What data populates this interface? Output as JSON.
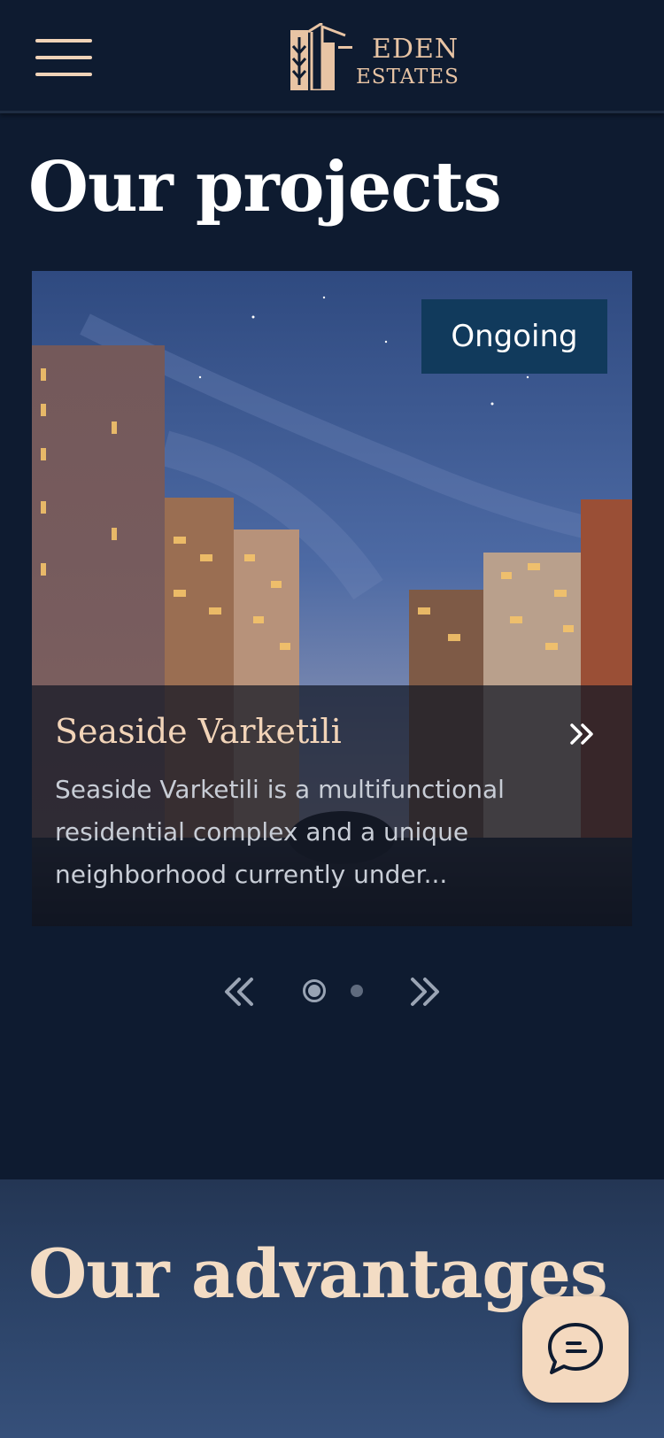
{
  "header": {
    "brand_line1": "EDEN",
    "brand_line2": "ESTATES",
    "menu_icon": "hamburger-menu-icon"
  },
  "projects": {
    "title": "Our projects",
    "card": {
      "status_badge": "Ongoing",
      "title": "Seaside Varketili",
      "description": "Seaside Varketili is a multifunctional residential complex and a unique neighborhood currently under...",
      "open_icon": "double-chevron-right-icon"
    },
    "carousel": {
      "prev_icon": "double-chevron-left-icon",
      "next_icon": "double-chevron-right-icon",
      "active_index": 1,
      "total_slides": 2
    }
  },
  "advantages": {
    "title": "Our advantages"
  },
  "chat": {
    "icon": "chat-bubble-icon"
  },
  "colors": {
    "background": "#0e1b30",
    "accent": "#f2d4b8",
    "badge": "#113a5c"
  }
}
